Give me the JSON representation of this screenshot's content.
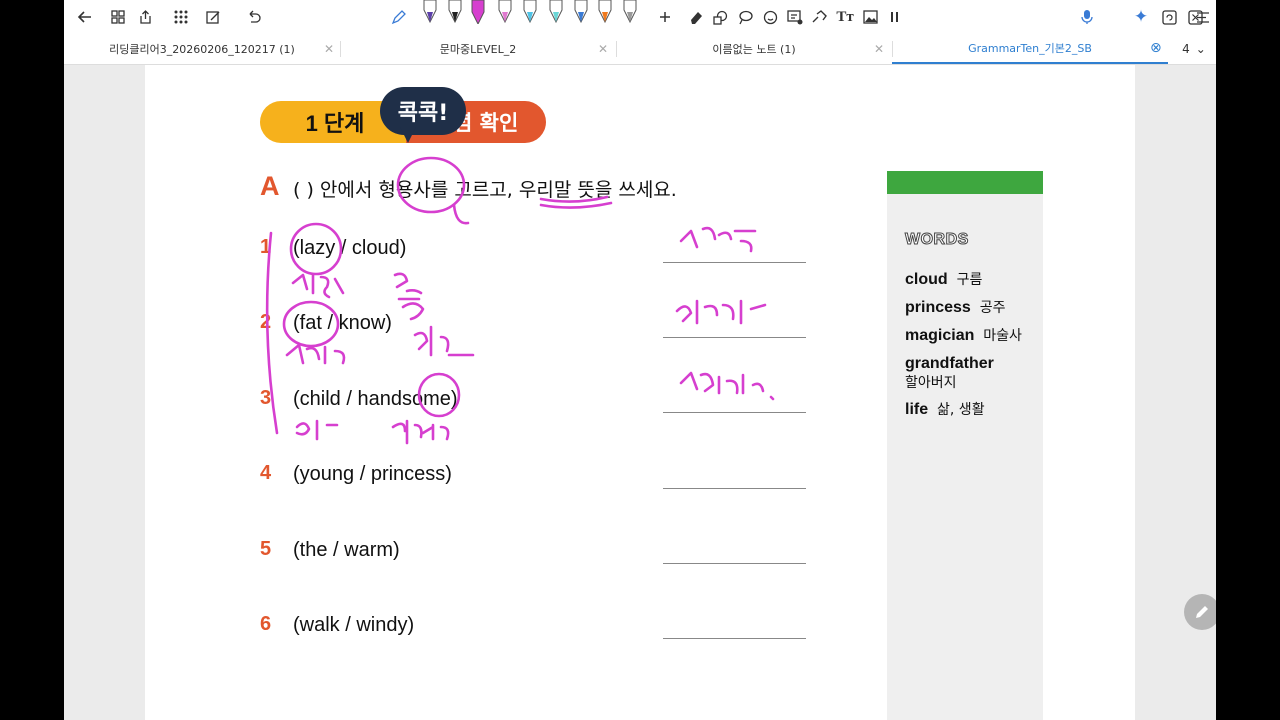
{
  "toolbar": {
    "pen_sizes": [
      "1.4",
      "1.4",
      "1.4",
      "1.4",
      "1.4",
      "1.4",
      "1.4",
      "7.5"
    ],
    "icons": [
      "back-icon",
      "grid-icon",
      "export-icon",
      "apps-icon",
      "edit-doc-icon",
      "undo-icon",
      "pen-tool-icon",
      "add-icon",
      "eraser-icon",
      "shapes-icon",
      "lasso-icon",
      "sticker-icon",
      "text-box-icon",
      "link-icon",
      "text-icon",
      "image-icon",
      "pause-icon",
      "mic-icon",
      "ai-sparkle-icon",
      "sync-icon",
      "close-icon",
      "menu-icon"
    ]
  },
  "tabs": [
    {
      "label": "리딩클리어3_20260206_120217 (1)"
    },
    {
      "label": "문마중LEVEL_2"
    },
    {
      "label": "이름없는 노트 (1)"
    },
    {
      "label": "GrammarTen_기본2_SB",
      "active": true
    }
  ],
  "tab_count": "4",
  "page": {
    "bubble": "콕콕!",
    "step_number": "1 단계",
    "step_title": "개념 확인",
    "section_letter": "A",
    "instruction": "(    ) 안에서 형용사를 고르고, 우리말 뜻을 쓰세요.",
    "questions": [
      {
        "num": "1",
        "text": "(lazy / cloud)"
      },
      {
        "num": "2",
        "text": "(fat / know)"
      },
      {
        "num": "3",
        "text": "(child / handsome)"
      },
      {
        "num": "4",
        "text": "(young / princess)"
      },
      {
        "num": "5",
        "text": "(the / warm)"
      },
      {
        "num": "6",
        "text": "(walk / windy)"
      }
    ]
  },
  "words": {
    "title": "WORDS",
    "items": [
      {
        "en": "cloud",
        "ko": "구름"
      },
      {
        "en": "princess",
        "ko": "공주"
      },
      {
        "en": "magician",
        "ko": "마술사"
      },
      {
        "en": "grandfather",
        "ko": "할아버지"
      },
      {
        "en": "life",
        "ko": "삶, 생활"
      }
    ]
  },
  "colors": {
    "accent_orange": "#e2572e",
    "accent_yellow": "#f6b11c",
    "words_green": "#3ea73f",
    "ink": "#d63fcf"
  }
}
